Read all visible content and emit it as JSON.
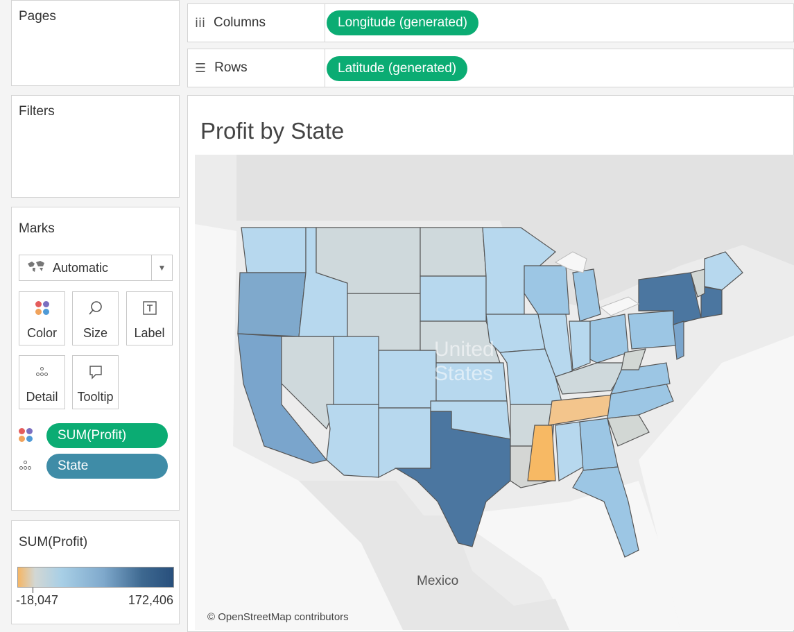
{
  "shelves": {
    "pages_title": "Pages",
    "filters_title": "Filters",
    "columns": {
      "label": "Columns",
      "icon": "columns-icon",
      "pill": "Longitude (generated)"
    },
    "rows": {
      "label": "Rows",
      "icon": "rows-icon",
      "pill": "Latitude (generated)"
    }
  },
  "marks": {
    "title": "Marks",
    "mark_type": "Automatic",
    "buttons": [
      {
        "label": "Color",
        "icon": "color-icon"
      },
      {
        "label": "Size",
        "icon": "size-icon"
      },
      {
        "label": "Label",
        "icon": "label-icon"
      },
      {
        "label": "Detail",
        "icon": "detail-icon"
      },
      {
        "label": "Tooltip",
        "icon": "tooltip-icon"
      }
    ],
    "pills": [
      {
        "label": "SUM(Profit)",
        "icon": "color-icon",
        "color": "#0bac73"
      },
      {
        "label": "State",
        "icon": "detail-icon",
        "color": "#3f8ca7"
      }
    ]
  },
  "legend": {
    "title": "SUM(Profit)",
    "min_label": "-18,047",
    "max_label": "172,406",
    "colors": [
      "#f5b665",
      "#d2d7d4",
      "#a8cfe6",
      "#7fa9cc",
      "#3d6890",
      "#284f7c"
    ]
  },
  "viz": {
    "title": "Profit by State",
    "map_labels": {
      "country": "United States",
      "neighbor": "Mexico"
    },
    "attribution": "© OpenStreetMap contributors"
  },
  "colors": {
    "pill_green": "#0bac73",
    "pill_teal": "#3f8ca7",
    "state_very_high": "#4b76a0",
    "state_high": "#7aa5cc",
    "state_mid": "#9cc6e4",
    "state_low": "#b7d8ee",
    "state_near_zero": "#cfd9dc",
    "state_negative": "#f3c58c",
    "state_most_negative": "#f7b964"
  }
}
